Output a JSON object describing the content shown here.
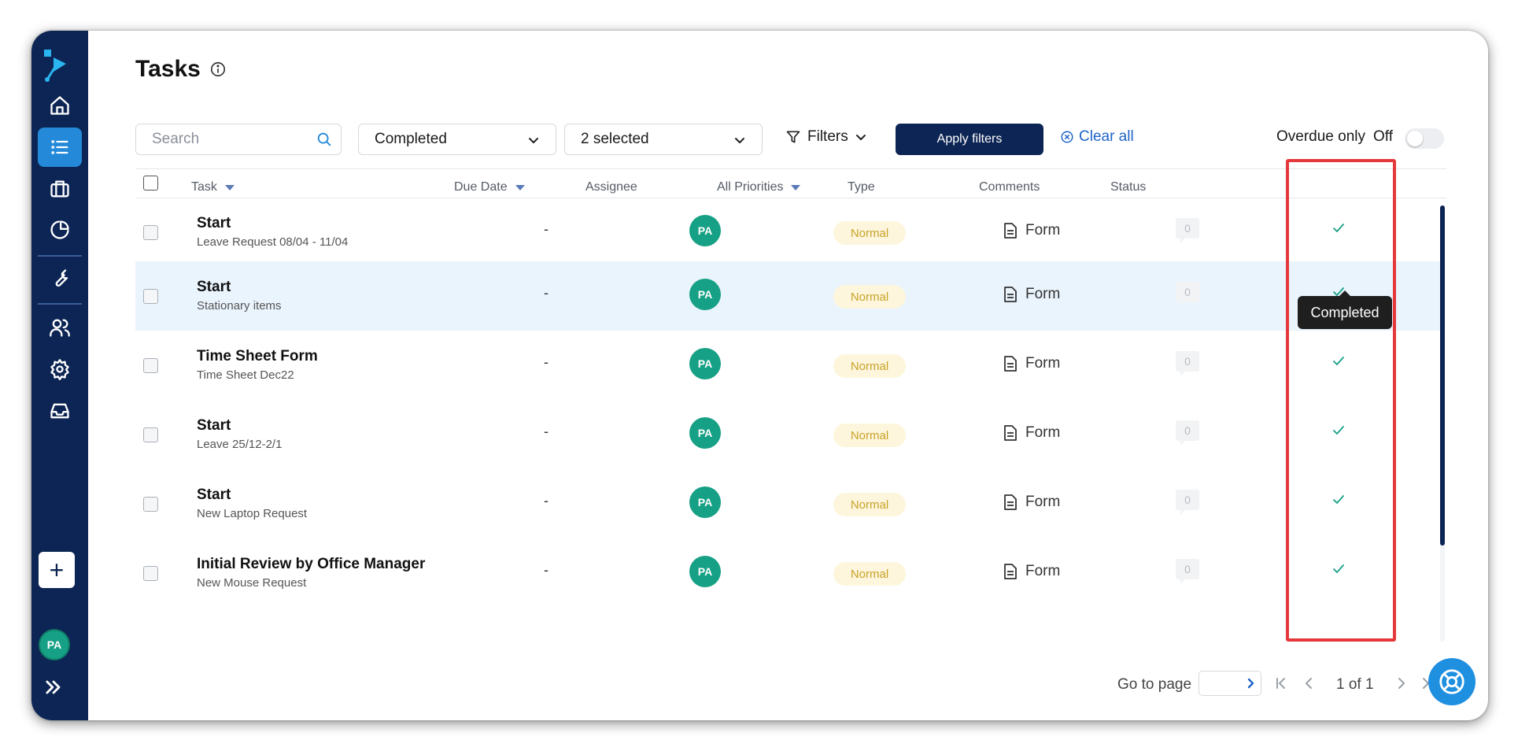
{
  "page": {
    "title": "Tasks"
  },
  "toolbar": {
    "search_placeholder": "Search",
    "status_filter": "Completed",
    "multi_filter": "2 selected",
    "filters_label": "Filters",
    "apply_label": "Apply filters",
    "clear_label": "Clear all",
    "overdue_label": "Overdue only",
    "overdue_state": "Off"
  },
  "columns": {
    "task": "Task",
    "due": "Due Date",
    "assignee": "Assignee",
    "priority": "All Priorities",
    "type": "Type",
    "comments": "Comments",
    "status": "Status"
  },
  "rows": [
    {
      "title": "Start",
      "subtitle": "Leave Request 08/04 - 11/04",
      "due": "-",
      "assignee": "PA",
      "priority": "Normal",
      "type": "Form",
      "comments": "0",
      "status": "completed"
    },
    {
      "title": "Start",
      "subtitle": "Stationary items",
      "due": "-",
      "assignee": "PA",
      "priority": "Normal",
      "type": "Form",
      "comments": "0",
      "status": "completed"
    },
    {
      "title": "Time Sheet Form",
      "subtitle": "Time Sheet Dec22",
      "due": "-",
      "assignee": "PA",
      "priority": "Normal",
      "type": "Form",
      "comments": "0",
      "status": "completed"
    },
    {
      "title": "Start",
      "subtitle": "Leave 25/12-2/1",
      "due": "-",
      "assignee": "PA",
      "priority": "Normal",
      "type": "Form",
      "comments": "0",
      "status": "completed"
    },
    {
      "title": "Start",
      "subtitle": "New Laptop Request",
      "due": "-",
      "assignee": "PA",
      "priority": "Normal",
      "type": "Form",
      "comments": "0",
      "status": "completed"
    },
    {
      "title": "Initial Review by Office Manager",
      "subtitle": "New Mouse Request",
      "due": "-",
      "assignee": "PA",
      "priority": "Normal",
      "type": "Form",
      "comments": "0",
      "status": "completed"
    }
  ],
  "tooltip": {
    "text": "Completed"
  },
  "pagination": {
    "goto_label": "Go to page",
    "page_info": "1 of 1"
  },
  "sidebar": {
    "avatar": "PA",
    "active_item": "tasks"
  },
  "colors": {
    "navy": "#0d2554",
    "accent": "#2389d8",
    "assignee": "#16a085",
    "highlight_box": "#e5383b"
  }
}
